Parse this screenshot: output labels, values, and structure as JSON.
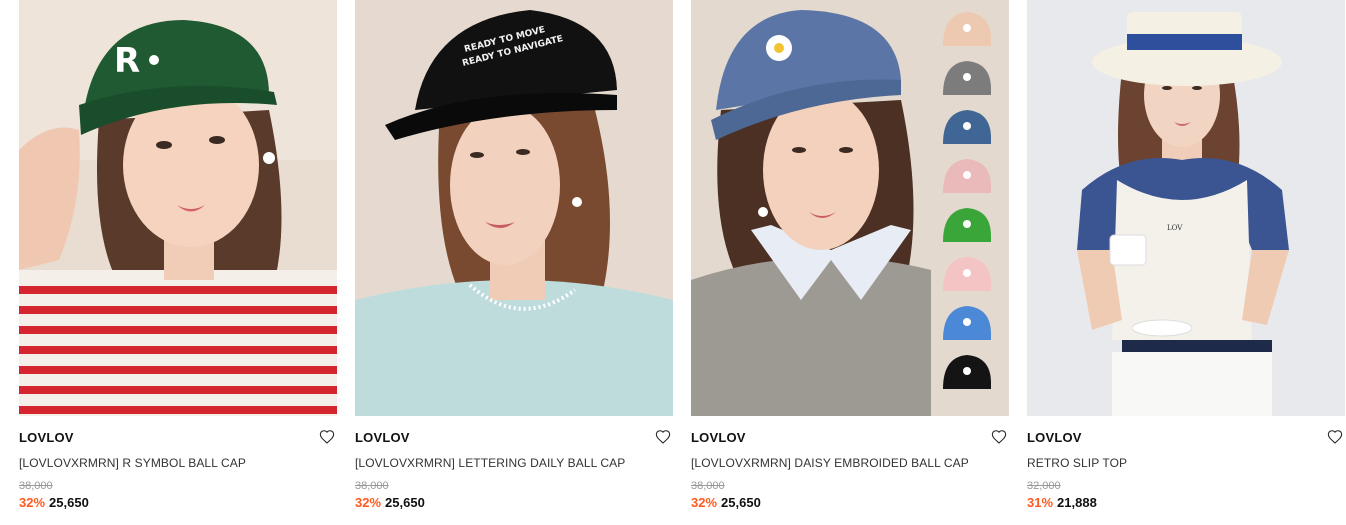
{
  "products": [
    {
      "brand": "LOVLOV",
      "name": "[LOVLOVXRMRN] R SYMBOL BALL CAP",
      "original_price": "38,000",
      "discount": "32%",
      "price": "25,650",
      "image_desc": "model-green-cap-striped-shirt",
      "cap_color": "#1f5a32",
      "cap_text": "R"
    },
    {
      "brand": "LOVLOV",
      "name": "[LOVLOVXRMRN] LETTERING DAILY BALL CAP",
      "original_price": "38,000",
      "discount": "32%",
      "price": "25,650",
      "image_desc": "model-black-cap-mint-shirt",
      "cap_color": "#111111",
      "cap_text_lines": [
        "READY TO MOVE",
        "READY TO NAVIGATE"
      ]
    },
    {
      "brand": "LOVLOV",
      "name": "[LOVLOVXRMRN] DAISY EMBROIDED BALL CAP",
      "original_price": "38,000",
      "discount": "32%",
      "price": "25,650",
      "image_desc": "model-blue-daisy-cap-with-color-swatches",
      "cap_color": "#5b76a6",
      "swatch_colors": [
        "#ecc9b0",
        "#7c7c7c",
        "#3f6694",
        "#eab9b9",
        "#3aa63a",
        "#f4c3c3",
        "#4b89d6",
        "#141414"
      ]
    },
    {
      "brand": "LOVLOV",
      "name": "RETRO SLIP TOP",
      "original_price": "32,000",
      "discount": "31%",
      "price": "21,888",
      "image_desc": "model-white-hat-navy-top",
      "hat_color": "#f4f0e4",
      "band_color": "#2e4f9c"
    }
  ],
  "colors": {
    "discount": "#ff5a1f",
    "original_price": "#999999"
  },
  "icons": {
    "wishlist": "heart-outline-icon"
  }
}
